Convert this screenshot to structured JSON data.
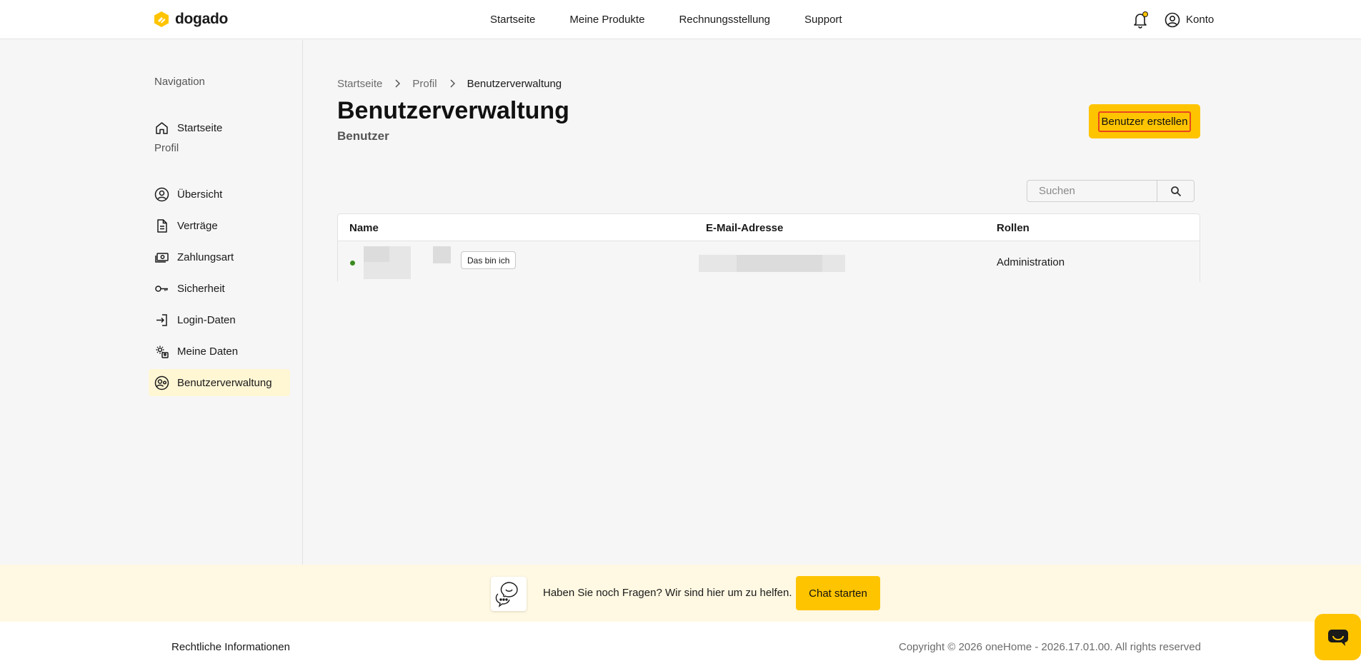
{
  "header": {
    "brand": "dogado",
    "nav": [
      "Startseite",
      "Meine Produkte",
      "Rechnungsstellung",
      "Support"
    ],
    "account_label": "Konto"
  },
  "sidebar": {
    "section_navigation": "Navigation",
    "home": "Startseite",
    "section_profile": "Profil",
    "items": [
      {
        "label": "Übersicht",
        "icon": "user-circle-icon"
      },
      {
        "label": "Verträge",
        "icon": "document-icon"
      },
      {
        "label": "Zahlungsart",
        "icon": "payment-icon"
      },
      {
        "label": "Sicherheit",
        "icon": "key-icon"
      },
      {
        "label": "Login-Daten",
        "icon": "login-icon"
      },
      {
        "label": "Meine Daten",
        "icon": "user-settings-icon"
      },
      {
        "label": "Benutzerverwaltung",
        "icon": "user-management-icon"
      }
    ],
    "active": "Benutzerverwaltung"
  },
  "breadcrumb": [
    "Startseite",
    "Profil",
    "Benutzerverwaltung"
  ],
  "page": {
    "title": "Benutzerverwaltung",
    "subtitle": "Benutzer",
    "create_button": "Benutzer erstellen"
  },
  "search": {
    "placeholder": "Suchen"
  },
  "table": {
    "columns": [
      "Name",
      "E-Mail-Adresse",
      "Rollen"
    ],
    "rows": [
      {
        "me_badge": "Das bin ich",
        "role": "Administration"
      }
    ]
  },
  "help": {
    "text": "Haben Sie noch Fragen? Wir sind hier um zu helfen.",
    "button": "Chat starten"
  },
  "footer": {
    "legal": "Rechtliche Informationen",
    "copyright": "Copyright © 2026 oneHome - 2026.17.01.00. All rights reserved"
  },
  "colors": {
    "accent": "#ffc400",
    "active_bg": "#fff6d4",
    "status_online": "#3a8a1f"
  }
}
